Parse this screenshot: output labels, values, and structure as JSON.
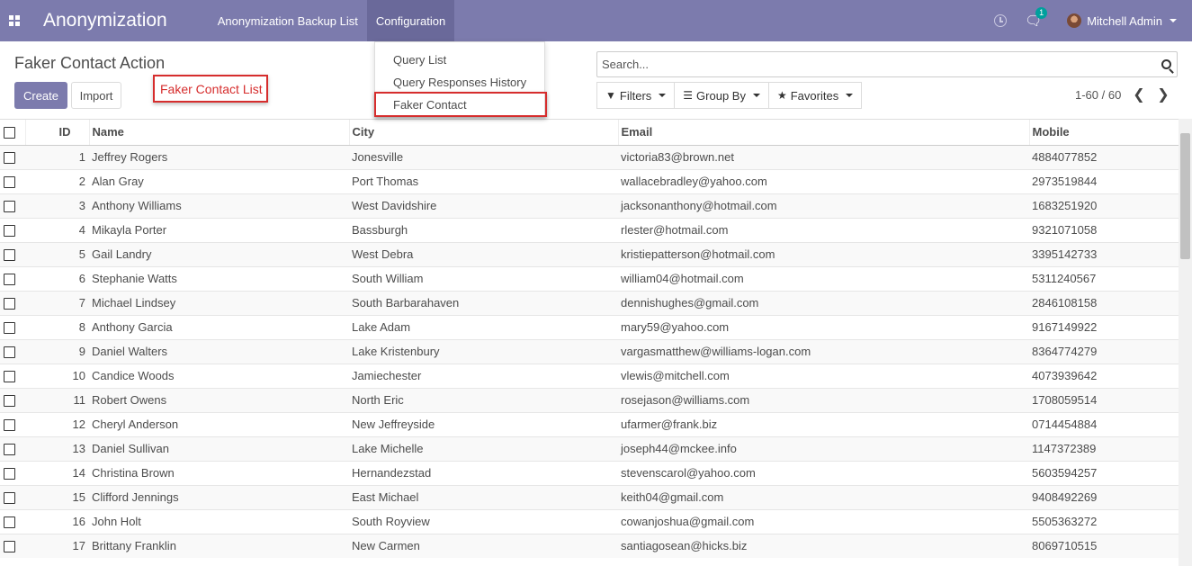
{
  "navbar": {
    "app_title": "Anonymization",
    "menu": [
      "Anonymization Backup List",
      "Configuration"
    ],
    "chat_badge": "1",
    "user_name": "Mitchell Admin"
  },
  "control_panel": {
    "breadcrumb": "Faker Contact Action",
    "create_label": "Create",
    "import_label": "Import",
    "callout_label": "Faker Contact List",
    "search_placeholder": "Search...",
    "filters_label": "Filters",
    "groupby_label": "Group By",
    "favorites_label": "Favorites",
    "pager": "1-60 / 60"
  },
  "dropdown": {
    "items": [
      "Query List",
      "Query Responses History",
      "Faker Contact"
    ]
  },
  "table": {
    "headers": [
      "ID",
      "Name",
      "City",
      "Email",
      "Mobile"
    ],
    "rows": [
      [
        "1",
        "Jeffrey Rogers",
        "Jonesville",
        "victoria83@brown.net",
        "4884077852"
      ],
      [
        "2",
        "Alan Gray",
        "Port Thomas",
        "wallacebradley@yahoo.com",
        "2973519844"
      ],
      [
        "3",
        "Anthony Williams",
        "West Davidshire",
        "jacksonanthony@hotmail.com",
        "1683251920"
      ],
      [
        "4",
        "Mikayla Porter",
        "Bassburgh",
        "rlester@hotmail.com",
        "9321071058"
      ],
      [
        "5",
        "Gail Landry",
        "West Debra",
        "kristiepatterson@hotmail.com",
        "3395142733"
      ],
      [
        "6",
        "Stephanie Watts",
        "South William",
        "william04@hotmail.com",
        "5311240567"
      ],
      [
        "7",
        "Michael Lindsey",
        "South Barbarahaven",
        "dennishughes@gmail.com",
        "2846108158"
      ],
      [
        "8",
        "Anthony Garcia",
        "Lake Adam",
        "mary59@yahoo.com",
        "9167149922"
      ],
      [
        "9",
        "Daniel Walters",
        "Lake Kristenbury",
        "vargasmatthew@williams-logan.com",
        "8364774279"
      ],
      [
        "10",
        "Candice Woods",
        "Jamiechester",
        "vlewis@mitchell.com",
        "4073939642"
      ],
      [
        "11",
        "Robert Owens",
        "North Eric",
        "rosejason@williams.com",
        "1708059514"
      ],
      [
        "12",
        "Cheryl Anderson",
        "New Jeffreyside",
        "ufarmer@frank.biz",
        "0714454884"
      ],
      [
        "13",
        "Daniel Sullivan",
        "Lake Michelle",
        "joseph44@mckee.info",
        "1147372389"
      ],
      [
        "14",
        "Christina Brown",
        "Hernandezstad",
        "stevenscarol@yahoo.com",
        "5603594257"
      ],
      [
        "15",
        "Clifford Jennings",
        "East Michael",
        "keith04@gmail.com",
        "9408492269"
      ],
      [
        "16",
        "John Holt",
        "South Royview",
        "cowanjoshua@gmail.com",
        "5505363272"
      ],
      [
        "17",
        "Brittany Franklin",
        "New Carmen",
        "santiagosean@hicks.biz",
        "8069710515"
      ]
    ]
  },
  "colors": {
    "navbar": "#7c7bad",
    "highlight": "#d62d2d"
  }
}
